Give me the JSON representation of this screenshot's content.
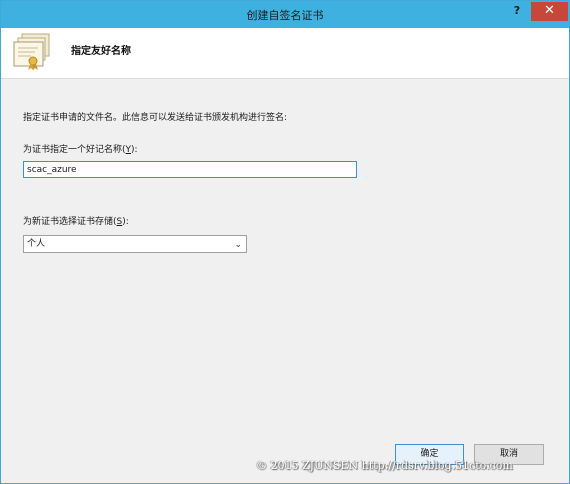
{
  "window": {
    "title": "创建自签名证书",
    "help_glyph": "?",
    "close_glyph": "✕"
  },
  "header": {
    "title": "指定友好名称",
    "icon": "certificate-icon"
  },
  "form": {
    "description": "指定证书申请的文件名。此信息可以发送给证书颁发机构进行签名:",
    "friendly_name_label_pre": "为证书指定一个好记名称(",
    "friendly_name_label_key": "Y",
    "friendly_name_label_post": "):",
    "friendly_name_value": "scac_azure",
    "store_label_pre": "为新证书选择证书存储(",
    "store_label_key": "S",
    "store_label_post": "):",
    "store_selected": "个人",
    "store_chevron_icon": "chevron-down-icon"
  },
  "buttons": {
    "ok": "确定",
    "cancel": "取消"
  },
  "watermark": "© 2015 ZJUNSEN http://rdsrv.blog.51cto.com",
  "colors": {
    "titlebar": "#3fb1e1",
    "close": "#c7483a",
    "accent_border": "#3d8fd1"
  }
}
